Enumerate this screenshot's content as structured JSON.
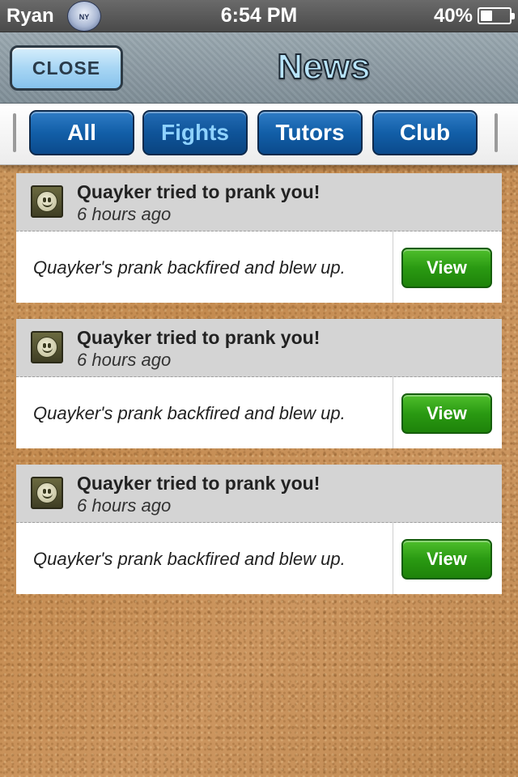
{
  "status_bar": {
    "carrier": "Ryan",
    "carrier_logo_icon": "yankees-logo-icon",
    "time": "6:54 PM",
    "battery_percent": "40%",
    "battery_level": 0.4
  },
  "header": {
    "close_label": "CLOSE",
    "title": "News"
  },
  "tabs": [
    {
      "label": "All",
      "selected": false
    },
    {
      "label": "Fights",
      "selected": true
    },
    {
      "label": "Tutors",
      "selected": false
    },
    {
      "label": "Club",
      "selected": false
    }
  ],
  "news": [
    {
      "icon": "smiley-icon",
      "title": "Quayker tried to prank you!",
      "time": "6 hours ago",
      "text": "Quayker's prank backfired and blew up.",
      "action_label": "View"
    },
    {
      "icon": "smiley-icon",
      "title": "Quayker tried to prank you!",
      "time": "6 hours ago",
      "text": "Quayker's prank backfired and blew up.",
      "action_label": "View"
    },
    {
      "icon": "smiley-icon",
      "title": "Quayker tried to prank you!",
      "time": "6 hours ago",
      "text": "Quayker's prank backfired and blew up.",
      "action_label": "View"
    }
  ],
  "colors": {
    "tab_blue": "#125fa8",
    "tab_selected_text": "#8ed2ff",
    "view_green": "#2a9a12",
    "cork": "#c8935a"
  }
}
